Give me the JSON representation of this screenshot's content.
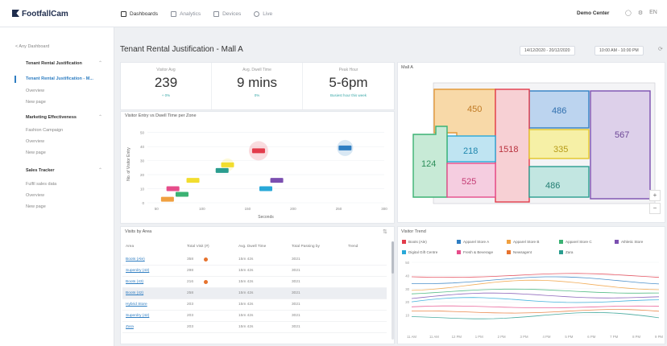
{
  "brand": {
    "name": "FootfallCam"
  },
  "nav": {
    "tabs": [
      {
        "label": "Dashboards",
        "active": true
      },
      {
        "label": "Analytics",
        "active": false
      },
      {
        "label": "Devices",
        "active": false
      },
      {
        "label": "Live",
        "active": false
      }
    ]
  },
  "user": {
    "name": "Demo Center"
  },
  "sidebar": {
    "back": "< Any Dashboard",
    "groups": [
      {
        "title": "Tenant Rental Justification",
        "items": [
          "Tenant Rental Justification - M...",
          "Overview",
          "New page"
        ]
      },
      {
        "title": "Marketing Effectiveness",
        "items": [
          "Fashion Campaign",
          "Overview",
          "New page"
        ]
      },
      {
        "title": "Sales Tracker",
        "items": [
          "Fulfil sales data",
          "Overview",
          "New page"
        ]
      }
    ]
  },
  "page": {
    "title": "Tenant Rental Justification - Mall A",
    "date_range": "14/12/2020 - 20/12/2020",
    "time_range": "10:00 AM - 10:00 PM"
  },
  "kpis": [
    {
      "label": "Visitor Avg",
      "value": "239",
      "foot": "+ 0%"
    },
    {
      "label": "Avg. Dwell Time",
      "value": "9 mins",
      "foot": "0%"
    },
    {
      "label": "Peak Hour",
      "value": "5-6pm",
      "foot": "Busiest hour this week"
    }
  ],
  "floorplan": {
    "title": "Mall A",
    "zones": [
      "450",
      "486",
      "567",
      "1518",
      "218",
      "335",
      "124",
      "525",
      "486"
    ]
  },
  "scatter": {
    "title": "Visitor Entry vs Dwell Time per Zone"
  },
  "chart_data": {
    "type": "scatter",
    "title": "Visitor Entry vs Dwell Time per Zone",
    "xlabel": "Seconds",
    "ylabel": "No. of Visitor Entry",
    "xticks": [
      "50",
      "100",
      "150",
      "200",
      "250",
      "300"
    ],
    "yticks": [
      "0",
      "10",
      "20",
      "30",
      "40",
      "50"
    ],
    "xlim": [
      40,
      300
    ],
    "ylim": [
      0,
      55
    ],
    "points": [
      {
        "x": 62,
        "y": 2.5,
        "color": "#f0a040",
        "r": 0
      },
      {
        "x": 68,
        "y": 10,
        "color": "#e64c8a",
        "r": 0
      },
      {
        "x": 78,
        "y": 6,
        "color": "#3bb273",
        "r": 0
      },
      {
        "x": 90,
        "y": 16,
        "color": "#f2dd2e",
        "r": 0
      },
      {
        "x": 128,
        "y": 27,
        "color": "#f2dd2e",
        "r": 8
      },
      {
        "x": 122,
        "y": 23,
        "color": "#2a9d8f",
        "r": 0
      },
      {
        "x": 162,
        "y": 37,
        "color": "#e23c4b",
        "r": 12
      },
      {
        "x": 170,
        "y": 10,
        "color": "#28a8d8",
        "r": 0
      },
      {
        "x": 182,
        "y": 16,
        "color": "#7b4fb0",
        "r": 0
      },
      {
        "x": 257,
        "y": 39,
        "color": "#2f7ec2",
        "r": 10
      }
    ]
  },
  "visits_table": {
    "title": "Visits by Area",
    "headers": [
      "Area",
      "Total Visit (#)",
      "Avg. Dwell Time",
      "Total Passing by",
      "Trend"
    ],
    "rows": [
      {
        "area": "Boots (Ale)",
        "visits": "358",
        "dot": true,
        "dwell": "15m 42s",
        "passing": "3021"
      },
      {
        "area": "Superdry (43)",
        "visits": "298",
        "dot": false,
        "dwell": "15m 42s",
        "passing": "3021"
      },
      {
        "area": "Boots (43)",
        "visits": "216",
        "dot": true,
        "dwell": "15m 42s",
        "passing": "3021"
      },
      {
        "area": "Boots (42)",
        "visits": "258",
        "dot": false,
        "dwell": "15m 42s",
        "passing": "3021"
      },
      {
        "area": "Hybrid Store",
        "visits": "203",
        "dot": false,
        "dwell": "15m 42s",
        "passing": "3021"
      },
      {
        "area": "Superdry (42)",
        "visits": "203",
        "dot": false,
        "dwell": "15m 42s",
        "passing": "3021"
      },
      {
        "area": "Zara",
        "visits": "203",
        "dot": false,
        "dwell": "15m 42s",
        "passing": "3021"
      }
    ]
  },
  "trend": {
    "title": "Visitor Trend",
    "legend": [
      {
        "label": "Boots (Ale)",
        "color": "#e23c4b"
      },
      {
        "label": "Apparel Store A",
        "color": "#2f7ec2"
      },
      {
        "label": "Apparel Store B",
        "color": "#f0a040"
      },
      {
        "label": "Apparel Store C",
        "color": "#3bb273"
      },
      {
        "label": "Athletic Store",
        "color": "#7b4fb0"
      },
      {
        "label": "Digital Gift Centre",
        "color": "#28a8d8"
      },
      {
        "label": "Fresh & Beverage",
        "color": "#e64c8a"
      },
      {
        "label": "Newsagent",
        "color": "#e6732e"
      },
      {
        "label": "Zara",
        "color": "#2a9d8f"
      }
    ],
    "xticks": [
      "11 AM",
      "11 AM",
      "12 PM",
      "1 PM",
      "2 PM",
      "3 PM",
      "4 PM",
      "5 PM",
      "6 PM",
      "7 PM",
      "8 PM",
      "9 PM"
    ],
    "yticks": [
      "50",
      "40",
      "30",
      "20",
      "10"
    ]
  },
  "icons": {
    "refresh": "refresh-icon",
    "bell": "bell-icon",
    "settings": "gear-icon"
  }
}
